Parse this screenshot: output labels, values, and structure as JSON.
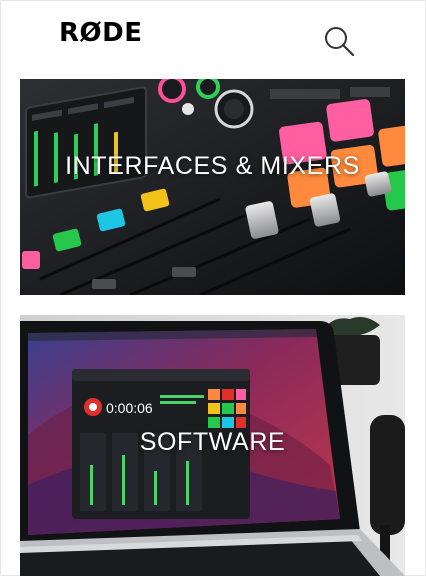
{
  "header": {
    "brand": "RØDE",
    "search_icon": "search-icon"
  },
  "categories": [
    {
      "label": "INTERFACES & MIXERS",
      "image": "mixer-photo"
    },
    {
      "label": "SOFTWARE",
      "image": "laptop-software-photo"
    }
  ],
  "software_screen": {
    "timer": "0:00:06"
  },
  "colors": {
    "pad_pink": "#ff5fa0",
    "pad_orange": "#ff8a3d",
    "pad_green": "#25c84a",
    "pad_cyan": "#1ec6e6",
    "pad_yellow": "#f2c11a",
    "record_red": "#e0302a"
  }
}
